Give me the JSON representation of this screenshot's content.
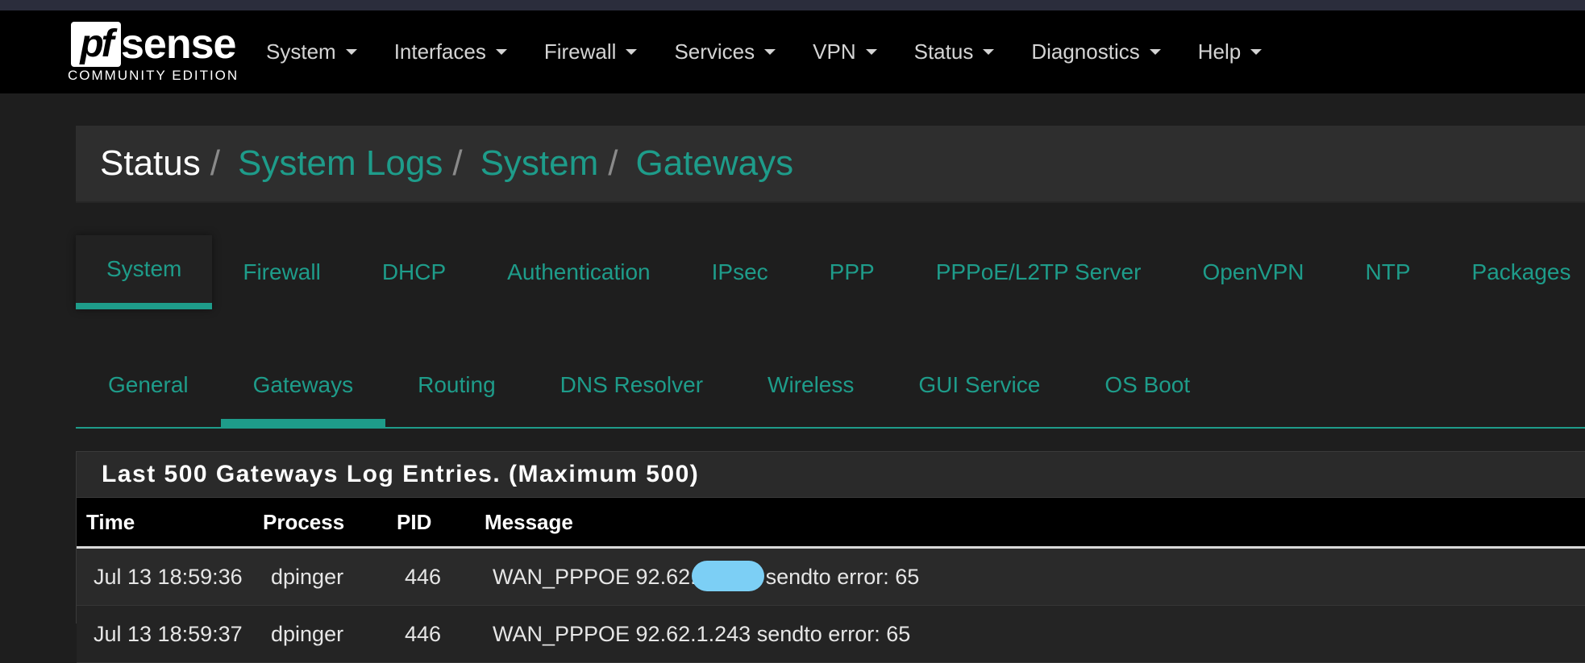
{
  "brand": {
    "logo_mark": "pf",
    "logo_word": "sense",
    "edition": "COMMUNITY EDITION"
  },
  "nav": [
    {
      "label": "System"
    },
    {
      "label": "Interfaces"
    },
    {
      "label": "Firewall"
    },
    {
      "label": "Services"
    },
    {
      "label": "VPN"
    },
    {
      "label": "Status"
    },
    {
      "label": "Diagnostics"
    },
    {
      "label": "Help"
    }
  ],
  "breadcrumb": {
    "root": "Status",
    "separator": "/",
    "links": [
      "System Logs",
      "System",
      "Gateways"
    ]
  },
  "log_tabs": [
    "System",
    "Firewall",
    "DHCP",
    "Authentication",
    "IPsec",
    "PPP",
    "PPPoE/L2TP Server",
    "OpenVPN",
    "NTP",
    "Packages"
  ],
  "log_tabs_active": "System",
  "system_tabs": [
    "General",
    "Gateways",
    "Routing",
    "DNS Resolver",
    "Wireless",
    "GUI Service",
    "OS Boot"
  ],
  "system_tabs_active": "Gateways",
  "panel": {
    "title": "Last 500 Gateways Log Entries. (Maximum 500)",
    "columns": {
      "time": "Time",
      "process": "Process",
      "pid": "PID",
      "message": "Message"
    },
    "rows": [
      {
        "time": "Jul 13 18:59:36",
        "process": "dpinger",
        "pid": "446",
        "message_prefix": "WAN_PPPOE 92.62.",
        "message_suffix": "sendto error: 65"
      },
      {
        "time": "Jul 13 18:59:37",
        "process": "dpinger",
        "pid": "446",
        "message_prefix": "WAN_PPPOE 92.62.1.243",
        "message_suffix": "sendto error: 65"
      }
    ]
  },
  "colors": {
    "accent": "#1e9c8a",
    "navbar": "#000000",
    "background": "#1e1e1e",
    "redaction": "#7ccff5"
  }
}
